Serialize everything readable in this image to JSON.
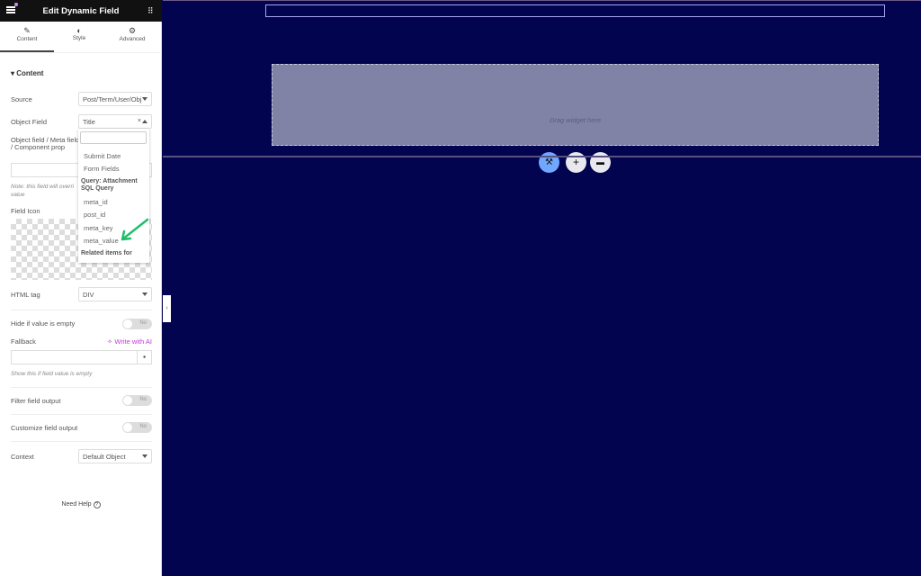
{
  "header": {
    "title": "Edit Dynamic Field",
    "menu_icon": "hamburger-icon",
    "grid_icon": "apps-grid-icon"
  },
  "tabs": [
    {
      "label": "Content",
      "icon": "pencil-icon"
    },
    {
      "label": "Style",
      "icon": "contrast-icon"
    },
    {
      "label": "Advanced",
      "icon": "gear-icon"
    }
  ],
  "section": {
    "title": "Content"
  },
  "fields": {
    "source_label": "Source",
    "source_value": "Post/Term/User/Obj",
    "object_field_label": "Object Field",
    "object_field_value": "Title",
    "meta_label": "Object field / Meta field / Component prop",
    "note": "Note: this field will overri value",
    "field_icon_label": "Field Icon",
    "html_tag_label": "HTML tag",
    "html_tag_value": "DIV",
    "hide_empty_label": "Hide if value is empty",
    "hide_empty_value": "No",
    "fallback_label": "Fallback",
    "write_ai": "Write with AI",
    "fallback_hint": "Show this if field value is empty",
    "filter_label": "Filter field output",
    "filter_value": "No",
    "customize_label": "Customize field output",
    "customize_value": "No",
    "context_label": "Context",
    "context_value": "Default Object",
    "need_help": "Need Help"
  },
  "dropdown": {
    "items": [
      "Submit Date",
      "Form Fields"
    ],
    "group": "Query: Attachment SQL Query",
    "group_items": [
      "meta_id",
      "post_id",
      "meta_key",
      "meta_value"
    ],
    "next_group": "Related items for"
  },
  "canvas": {
    "drag_text": "Drag widget here",
    "bg": "#02044f",
    "accent": "#71a8ff"
  }
}
